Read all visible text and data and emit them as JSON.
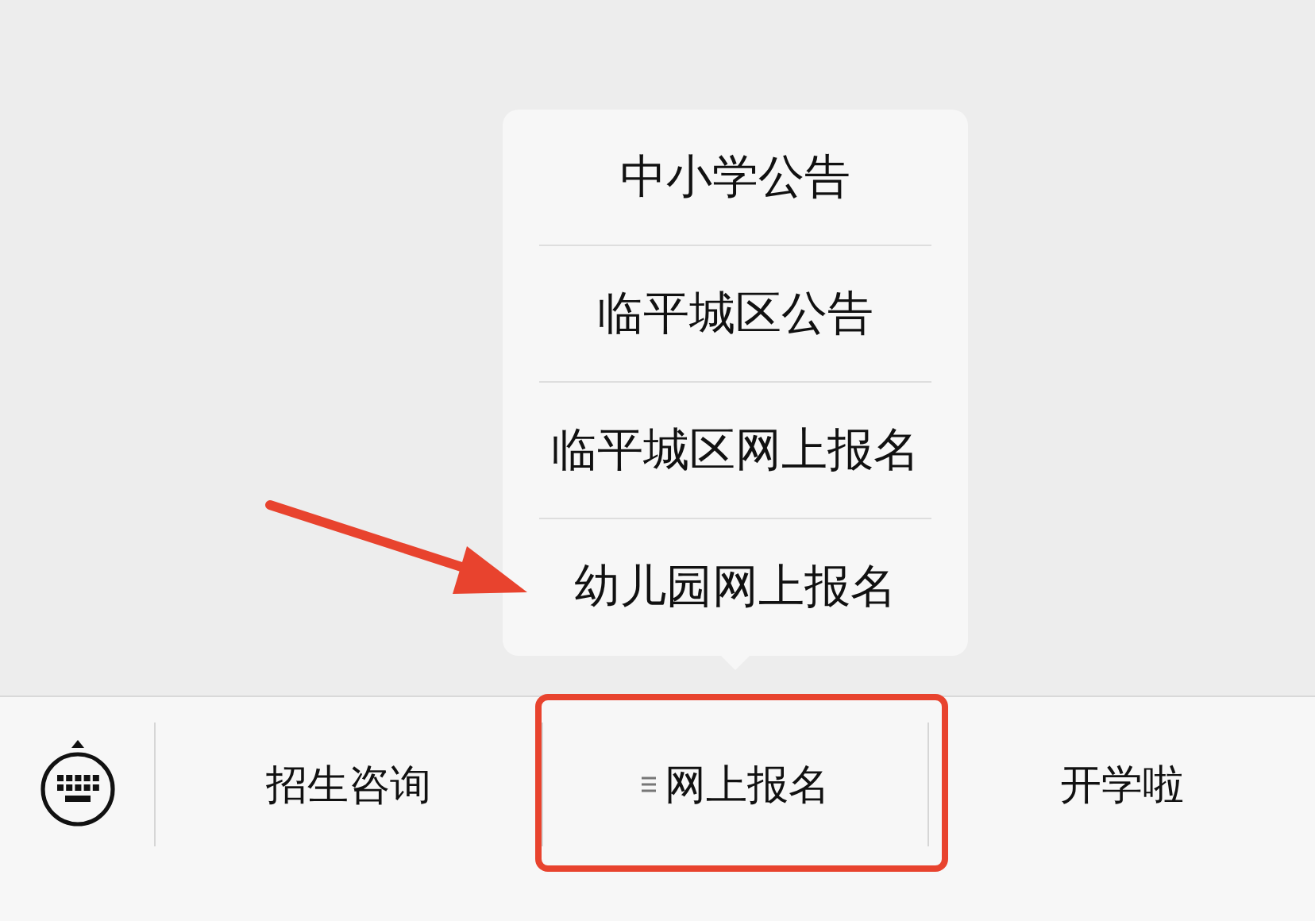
{
  "menu_bar": {
    "items": [
      {
        "label": "招生咨询",
        "has_submenu": false,
        "highlighted": false
      },
      {
        "label": "网上报名",
        "has_submenu": true,
        "highlighted": true,
        "submenu": [
          {
            "label": "中小学公告",
            "pointed_at": false
          },
          {
            "label": "临平城区公告",
            "pointed_at": false
          },
          {
            "label": "临平城区网上报名",
            "pointed_at": false
          },
          {
            "label": "幼儿园网上报名",
            "pointed_at": true
          }
        ]
      },
      {
        "label": "开学啦",
        "has_submenu": false,
        "highlighted": false
      }
    ]
  }
}
